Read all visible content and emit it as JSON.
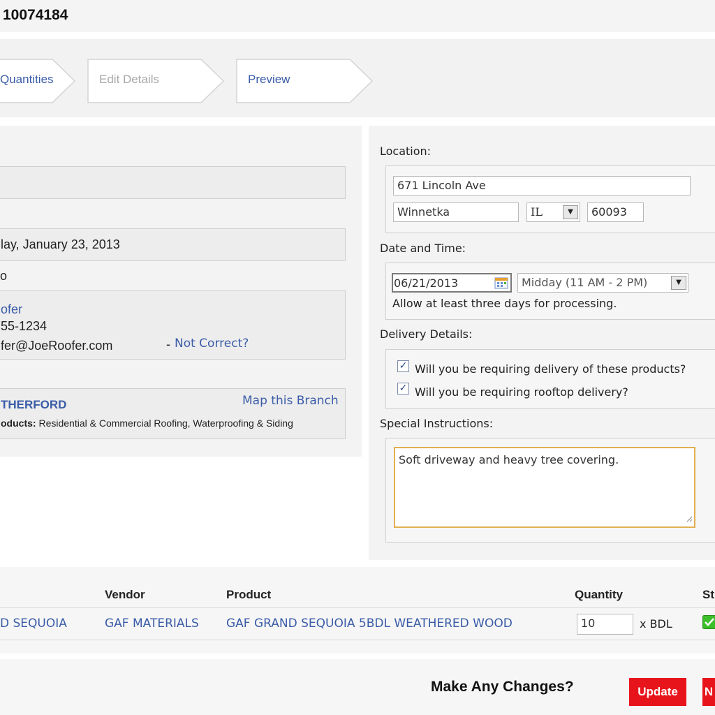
{
  "header": {
    "order_number": "10074184"
  },
  "steps": [
    {
      "label": "Quantities"
    },
    {
      "label": "Edit Details"
    },
    {
      "label": "Preview"
    }
  ],
  "left": {
    "box1_text": "",
    "date_text": "lay, January 23, 2013",
    "sub_label": "o",
    "contact": {
      "name": "ofer",
      "phone": "55-1234",
      "email": "fer@JoeRoofer.com",
      "dash": "-",
      "not_correct": "Not Correct?"
    },
    "branch": {
      "name": "THERFORD",
      "map_link": "Map this Branch",
      "products_label": "oducts:",
      "products_text": "Residential & Commercial Roofing, Waterproofing & Siding"
    }
  },
  "right": {
    "location_label": "Location:",
    "address": "671 Lincoln Ave",
    "city": "Winnetka",
    "state": "IL",
    "zip": "60093",
    "datetime_label": "Date and Time:",
    "date": "06/21/2013",
    "time_window": "Midday (11 AM - 2 PM)",
    "processing_note": "Allow at least three days for processing.",
    "delivery_label": "Delivery Details:",
    "delivery_q1": "Will you be requiring delivery of these products?",
    "delivery_q2": "Will you be requiring rooftop delivery?",
    "delivery_q1_checked": true,
    "delivery_q2_checked": true,
    "instructions_label": "Special Instructions:",
    "instructions_text": "Soft driveway and heavy tree covering."
  },
  "table": {
    "headers": {
      "vendor": "Vendor",
      "product": "Product",
      "quantity": "Quantity",
      "status": "St"
    },
    "row": {
      "name": "D SEQUOIA",
      "vendor": "GAF MATERIALS",
      "product": "GAF GRAND SEQUOIA 5BDL WEATHERED WOOD",
      "quantity": "10",
      "unit": "x BDL"
    }
  },
  "footer": {
    "prompt": "Make Any Changes?",
    "update_label": "Update",
    "next_label": "N"
  },
  "colors": {
    "link": "#3a5ca8",
    "button": "#e8141c",
    "textarea_border": "#e0b050",
    "status_ok": "#3cbf2a"
  }
}
